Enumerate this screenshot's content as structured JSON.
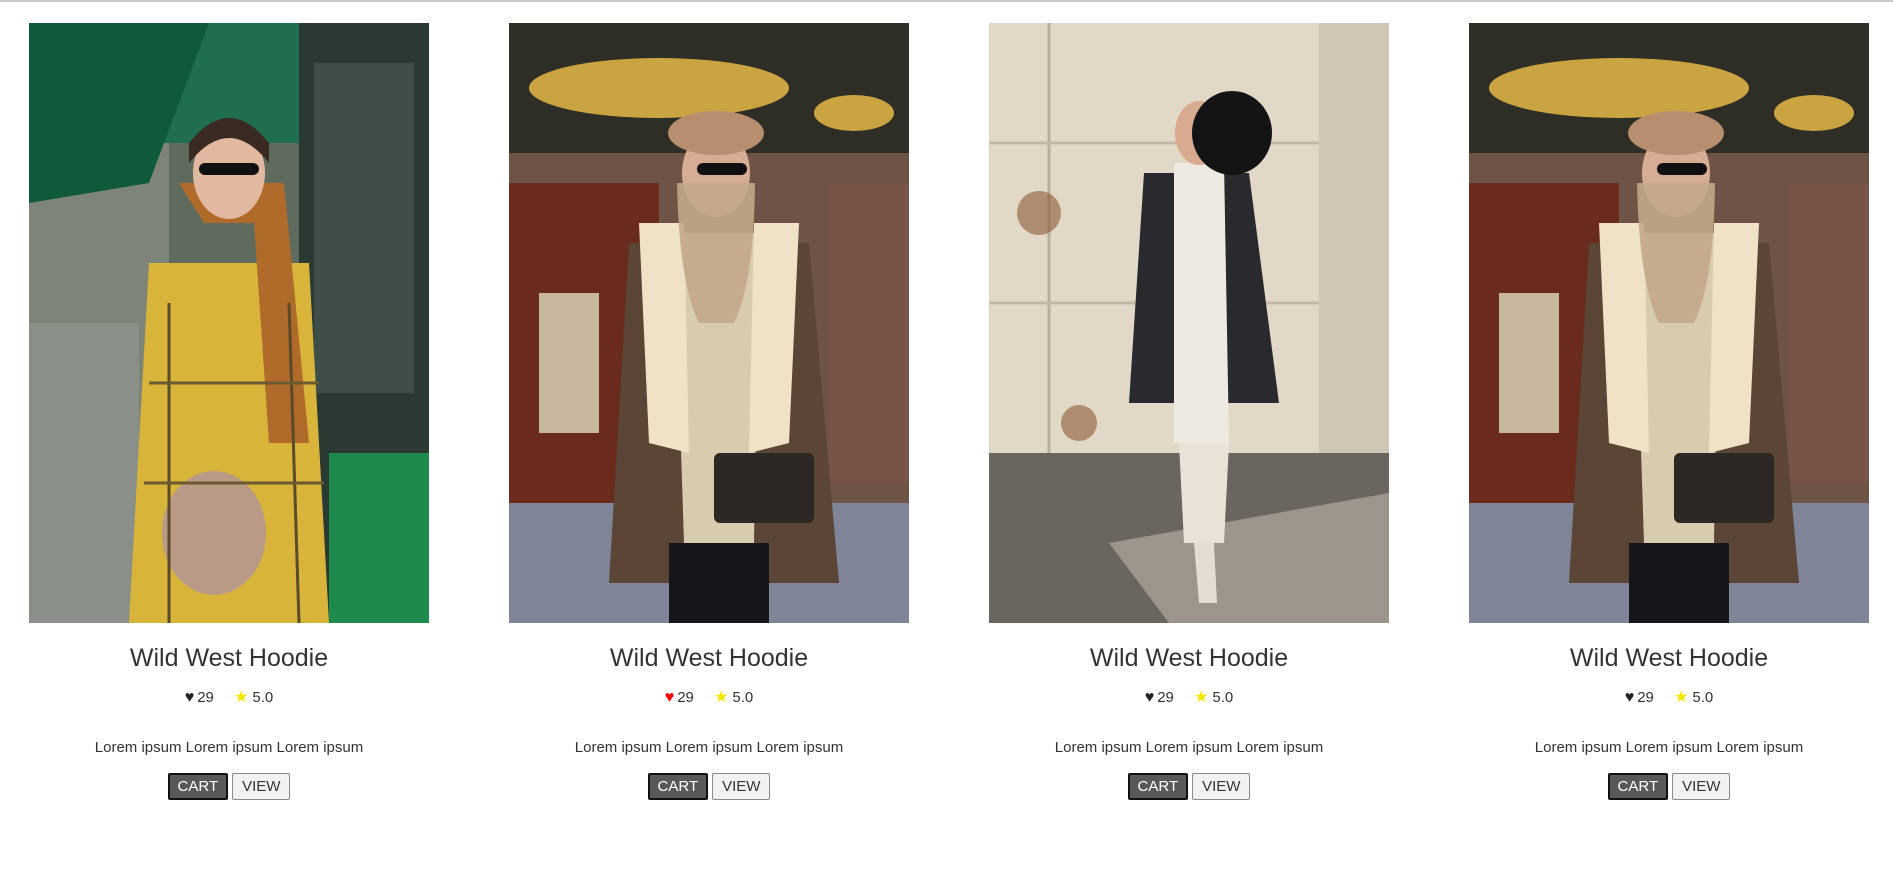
{
  "products": [
    {
      "title": "Wild West Hoodie",
      "likes": "29",
      "rating": "5.0",
      "liked": false,
      "description": "Lorem ipsum Lorem ipsum Lorem ipsum",
      "cart_label": "CART",
      "view_label": "VIEW",
      "image_alt": "Woman in yellow plaid coat with fur bag"
    },
    {
      "title": "Wild West Hoodie",
      "likes": "29",
      "rating": "5.0",
      "liked": true,
      "description": "Lorem ipsum Lorem ipsum Lorem ipsum",
      "cart_label": "CART",
      "view_label": "VIEW",
      "image_alt": "Woman in shearling jacket with cap and handbag"
    },
    {
      "title": "Wild West Hoodie",
      "likes": "29",
      "rating": "5.0",
      "liked": false,
      "description": "Lorem ipsum Lorem ipsum Lorem ipsum",
      "cart_label": "CART",
      "view_label": "VIEW",
      "image_alt": "Woman in black coat holding black hat"
    },
    {
      "title": "Wild West Hoodie",
      "likes": "29",
      "rating": "5.0",
      "liked": false,
      "description": "Lorem ipsum Lorem ipsum Lorem ipsum",
      "cart_label": "CART",
      "view_label": "VIEW",
      "image_alt": "Woman in shearling jacket with cap and handbag"
    }
  ],
  "icons": {
    "like": "heart-icon",
    "rating": "star-icon"
  },
  "colors": {
    "liked_heart": "#ff0000",
    "heart": "#222222",
    "star": "#f3e600",
    "cart_button": "#595959"
  }
}
